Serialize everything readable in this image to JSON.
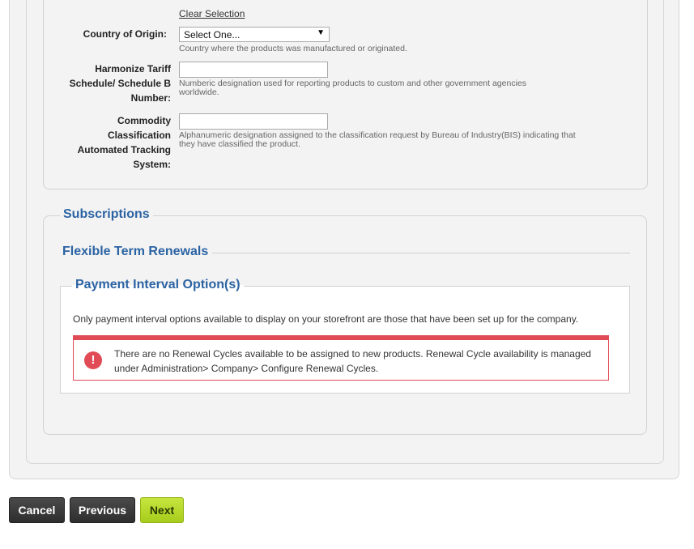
{
  "product_form": {
    "clear_selection": "Clear Selection",
    "country_of_origin": {
      "label": "Country of Origin:",
      "selected": "Select One...",
      "help": "Country where the products was manufactured or originated."
    },
    "hts": {
      "label_lines": [
        "Harmonize Tariff",
        "Schedule/ Schedule B",
        "Number:"
      ],
      "value": "",
      "help": "Numberic designation used for reporting products to custom and other government agencies worldwide."
    },
    "ccats": {
      "label_lines": [
        "Commodity",
        "Classification",
        "Automated Tracking",
        "System:"
      ],
      "value": "",
      "help": "Alphanumeric designation assigned to the classification request by Bureau of Industry(BIS) indicating that they have classified the product."
    }
  },
  "subscriptions": {
    "legend": "Subscriptions",
    "flexible_term_renewals": "Flexible Term Renewals",
    "payment_interval": {
      "legend": "Payment Interval Option(s)",
      "description": "Only payment interval options available to display on your storefront are those that have been set up for the company.",
      "alert": {
        "icon": "exclamation-icon",
        "text": "There are no Renewal Cycles available to be assigned to new products. Renewal Cycle availability is managed under Administration> Company> Configure Renewal Cycles."
      }
    }
  },
  "actions": {
    "cancel": "Cancel",
    "previous": "Previous",
    "next": "Next"
  },
  "colors": {
    "heading_blue": "#2b63a3",
    "alert_red": "#e04b56",
    "next_green": "#b5d72a",
    "panel_gray": "#f3f3f3"
  }
}
